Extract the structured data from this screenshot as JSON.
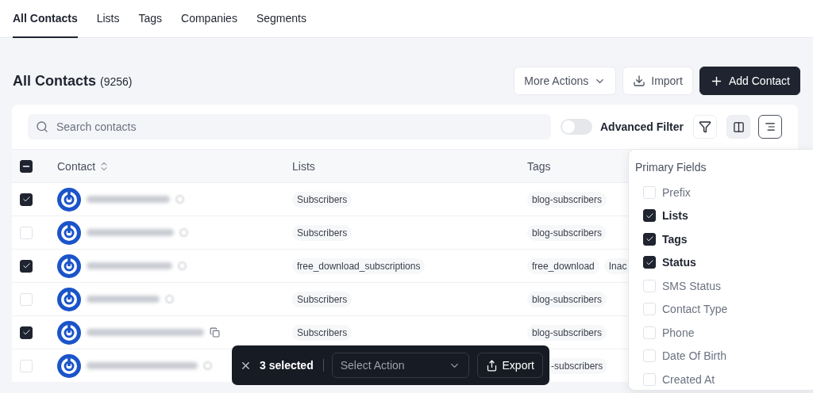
{
  "tabs": [
    {
      "label": "All Contacts",
      "selected": true
    },
    {
      "label": "Lists",
      "selected": false
    },
    {
      "label": "Tags",
      "selected": false
    },
    {
      "label": "Companies",
      "selected": false
    },
    {
      "label": "Segments",
      "selected": false
    }
  ],
  "header": {
    "title": "All Contacts",
    "count": "(9256)",
    "buttons": [
      {
        "label": "More Actions",
        "kind": "menu"
      },
      {
        "label": "Import",
        "kind": "import"
      },
      {
        "label": "Add Contact",
        "kind": "primary"
      }
    ]
  },
  "toolbar": {
    "search": {
      "placeholder": "Search contacts"
    },
    "advanced_filter": {
      "label": "Advanced Filter",
      "on": false
    }
  },
  "table": {
    "select_all_partial": true,
    "columns": [
      "Contact",
      "Lists",
      "Tags"
    ],
    "rows": [
      {
        "selected": true,
        "hovered": false,
        "lists": [
          "Subscribers"
        ],
        "tags": [
          "blog-subscribers"
        ]
      },
      {
        "selected": false,
        "hovered": false,
        "lists": [
          "Subscribers"
        ],
        "tags": [
          "blog-subscribers"
        ]
      },
      {
        "selected": true,
        "hovered": false,
        "lists": [
          "free_download_subscriptions"
        ],
        "tags": [
          "free_download",
          "Inac"
        ]
      },
      {
        "selected": false,
        "hovered": false,
        "lists": [
          "Subscribers"
        ],
        "tags": [
          "blog-subscribers"
        ]
      },
      {
        "selected": true,
        "hovered": true,
        "lists": [
          "Subscribers"
        ],
        "tags": [
          "blog-subscribers"
        ]
      },
      {
        "selected": false,
        "hovered": false,
        "tags": [
          "-subscribers"
        ],
        "tags_cut": true
      }
    ]
  },
  "columns_menu": {
    "title": "Primary Fields",
    "items": [
      {
        "label": "Prefix",
        "checked": false
      },
      {
        "label": "Lists",
        "checked": true
      },
      {
        "label": "Tags",
        "checked": true
      },
      {
        "label": "Status",
        "checked": true
      },
      {
        "label": "SMS Status",
        "checked": false
      },
      {
        "label": "Contact Type",
        "checked": false
      },
      {
        "label": "Phone",
        "checked": false
      },
      {
        "label": "Date Of Birth",
        "checked": false
      },
      {
        "label": "Created At",
        "checked": false
      }
    ]
  },
  "bulk_bar": {
    "count": "3 selected",
    "action": {
      "placeholder": "Select Action"
    },
    "export": "Export"
  }
}
